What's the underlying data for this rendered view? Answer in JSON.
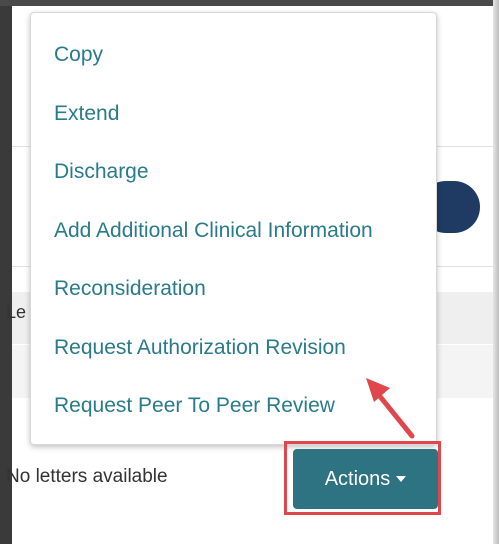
{
  "menu": {
    "items": [
      {
        "label": "Copy"
      },
      {
        "label": "Extend"
      },
      {
        "label": "Discharge"
      },
      {
        "label": "Add Additional Clinical Information"
      },
      {
        "label": "Reconsideration"
      },
      {
        "label": "Request Authorization Revision"
      },
      {
        "label": "Request Peer To Peer Review"
      }
    ]
  },
  "background": {
    "letters_column_fragment": "Le",
    "empty_message": "No letters available"
  },
  "actions_button": {
    "label": "Actions"
  },
  "colors": {
    "menu_text": "#2a7b8a",
    "actions_button": "#2e7381",
    "highlight": "#e0474c",
    "pill": "#1f3b63"
  },
  "icons": {
    "actions_caret": "caret-down-icon",
    "annotation": "arrow-annotation-icon"
  }
}
